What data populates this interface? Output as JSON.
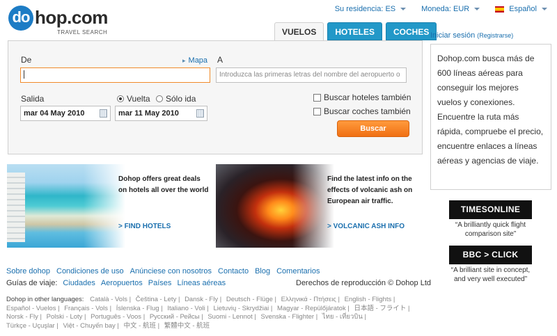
{
  "header": {
    "logo_text": "dohop.com",
    "logo_badge": "do",
    "tagline": "TRAVEL SEARCH",
    "residence": "Su residencia: ES",
    "currency": "Moneda: EUR",
    "language": "Español"
  },
  "tabs": [
    {
      "label": "VUELOS",
      "active": true
    },
    {
      "label": "HOTELES",
      "active": false
    },
    {
      "label": "COCHES",
      "active": false
    }
  ],
  "search": {
    "from_label": "De",
    "map_link": "Mapa",
    "to_label": "A",
    "to_placeholder": "Introduzca las primeras letras del nombre del aeropuerto o",
    "depart_label": "Salida",
    "depart_date": "mar 04 May 2010",
    "return_date": "mar 11 May 2010",
    "radio_return": "Vuelta",
    "radio_oneway": "Sólo ida",
    "check_hotels": "Buscar hoteles también",
    "check_cars": "Buscar coches también",
    "search_button": "Buscar"
  },
  "promos": [
    {
      "text": "Dohop offers great deals on hotels all over the world",
      "link": "> FIND HOTELS"
    },
    {
      "text": "Find the latest info on the effects of volcanic ash on European air traffic.",
      "link": "> VOLCANIC ASH INFO"
    }
  ],
  "sidebar": {
    "login": "Iniciar sesión",
    "register": "(Registrarse)",
    "info": "Dohop.com busca más de 600 líneas aéreas para conseguir los mejores vuelos y conexiones. Encuentre la ruta más rápida, compruebe el precio, encuentre enlaces a líneas aéreas y agencias de viaje.",
    "press": [
      {
        "logo_a": "TIMES",
        "logo_b": "ONLINE",
        "quote": "“A brilliantly quick flight comparison site”"
      },
      {
        "logo_a": "BBC",
        "logo_b": "> CLICK",
        "quote": "“A brilliant site in concept, and very well executed”"
      }
    ]
  },
  "footer": {
    "nav": [
      "Sobre dohop",
      "Condiciones de uso",
      "Anúnciese con nosotros",
      "Contacto",
      "Blog",
      "Comentarios"
    ],
    "guides_label": "Guías de viaje:",
    "guides": [
      "Ciudades",
      "Aeropuertos",
      "Países",
      "Líneas aéreas"
    ],
    "copyright": "Derechos de reproducción © Dohop Ltd",
    "langs_label": "Dohop in other languages:",
    "langs": [
      "Català - Vols",
      "Čeština - Lety",
      "Dansk - Fly",
      "Deutsch - Flüge",
      "Ελληνικά - Πτήσεις",
      "English - Flights",
      "Español - Vuelos",
      "Français - Vols",
      "Íslenska - Flug",
      "Italiano - Voli",
      "Lietuvių - Skrydžiai",
      "Magyar - Repülőjáratok",
      "日本語 - フライト",
      "Norsk - Fly",
      "Polski - Loty",
      "Português - Voos",
      "Русский - Рейсы",
      "Suomi - Lennot",
      "Svenska - Flighter",
      "ไทย - เที่ยวบิน",
      "Türkçe - Uçuşlar",
      "Việt - Chuyến bay",
      "中文 - 航班",
      "繁體中文 - 航班"
    ]
  }
}
